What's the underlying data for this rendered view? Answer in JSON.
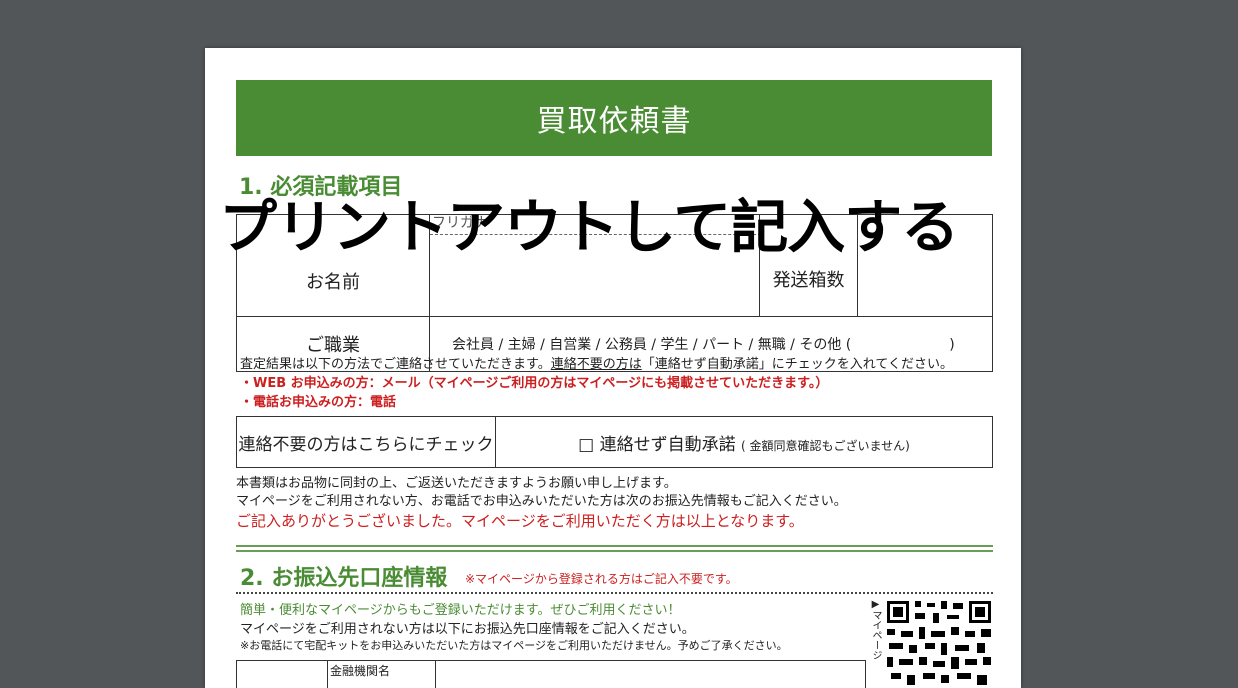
{
  "document": {
    "title": "買取依頼書",
    "overlay_text": "プリントアウトして記入する",
    "section1": {
      "heading": "1. 必須記載項目",
      "furigana_label": "フリガナ",
      "name_label": "お名前",
      "boxes_label": "発送箱数",
      "occupation_label": "ご職業",
      "occupation_options": "会社員 / 主婦 / 自営業 / 公務員 / 学生 / パート / 無職 / その他 (　　　　　　　)"
    },
    "contact_note": {
      "prefix": "査定結果は以下の方法でご連絡させていただきます。",
      "underlined": "連絡不要の方は",
      "suffix": "「連絡せず自動承諾」にチェックを入れてください。",
      "web_line": "・WEB お申込みの方：メール（マイページご利用の方はマイページにも掲載させていただきます。）",
      "phone_line": "・電話お申込みの方：電話"
    },
    "check_row": {
      "label": "連絡不要の方はこちらにチェック",
      "checkbox_text": "□ 連絡せず自動承諾",
      "checkbox_note": "( 金額同意確認もございません)"
    },
    "body_lines": {
      "line1": "本書類はお品物に同封の上、ご返送いただきますようお願い申し上げます。",
      "line2": "マイページをご利用されない方、お電話でお申込みいただいた方は次のお振込先情報もご記入ください。",
      "thanks": "ご記入ありがとうございました。マイページをご利用いただく方は以上となります。"
    },
    "section2": {
      "heading": "2. お振込先口座情報",
      "note": "※マイページから登録される方はご記入不要です。",
      "green_line": "簡単・便利なマイページからもご登録いただけます。ぜひご利用ください！",
      "line2": "マイページをご利用されない方は以下にお振込先口座情報をご記入ください。",
      "line3": "※お電話にて宅配キットをお申込みいただいた方はマイページをご利用いただけません。予めご了承ください。",
      "qr_label": "▶マイページ",
      "bank_label": "金融機関名"
    },
    "colors": {
      "accent_green": "#4a8c34",
      "alert_red": "#cc1f1f",
      "viewer_bg": "#525659"
    }
  }
}
